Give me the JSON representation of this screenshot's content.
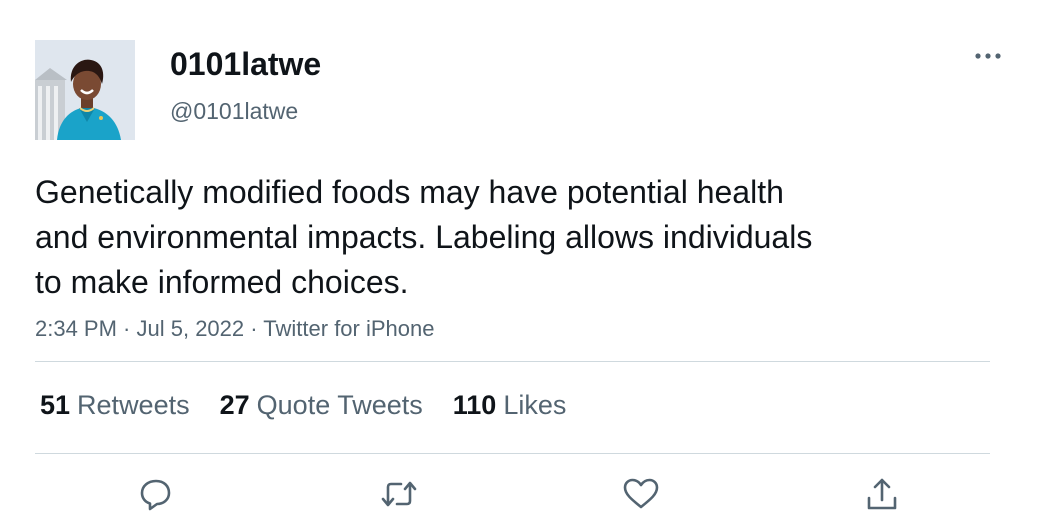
{
  "tweet": {
    "author": {
      "display_name": "0101latwe",
      "handle": "@0101latwe"
    },
    "text_lines": [
      "Genetically modified foods may have potential health",
      "and environmental impacts. Labeling allows individuals",
      "to make informed choices."
    ],
    "meta": {
      "time": "2:34 PM",
      "separator": " · ",
      "date": "Jul 5, 2022",
      "source": "Twitter for iPhone"
    },
    "stats": [
      {
        "count": "51",
        "label": "Retweets"
      },
      {
        "count": "27",
        "label": "Quote Tweets"
      },
      {
        "count": "110",
        "label": "Likes"
      }
    ],
    "actions": [
      "reply-icon",
      "retweet-icon",
      "like-icon",
      "share-icon"
    ],
    "colors": {
      "text": "#0f1419",
      "secondary": "#536471",
      "divider": "#cfd9de",
      "action_icon": "#536471"
    }
  }
}
